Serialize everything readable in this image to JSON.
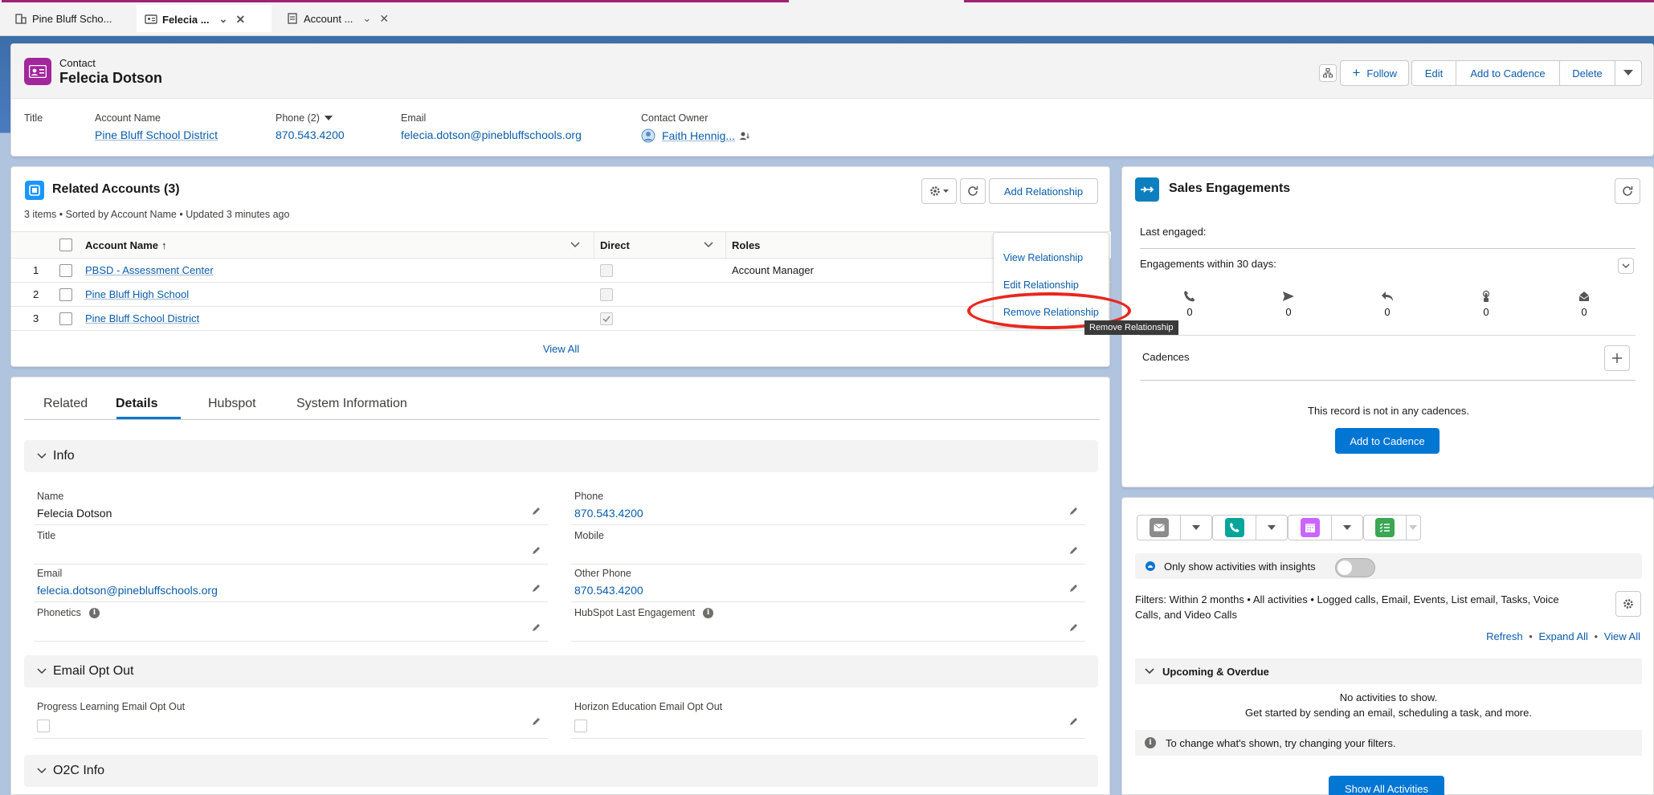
{
  "browser_tabs": [
    {
      "label": "Pine Bluff Scho...",
      "icon": "building-icon"
    },
    {
      "label": "Felecia ...",
      "icon": "contact-card-icon"
    },
    {
      "label": "Account ...",
      "icon": "page-icon"
    }
  ],
  "highlights": {
    "object_label": "Contact",
    "record_name": "Felecia Dotson",
    "actions": {
      "follow": "Follow",
      "edit": "Edit",
      "add_to_cadence": "Add to Cadence",
      "delete": "Delete"
    },
    "fields": {
      "title_label": "Title",
      "account_label": "Account Name",
      "account_value": "Pine Bluff School District",
      "phone_label": "Phone (2)",
      "phone_value": "870.543.4200",
      "email_label": "Email",
      "email_value": "felecia.dotson@pinebluffschools.org",
      "owner_label": "Contact Owner",
      "owner_value": "Faith Hennig..."
    }
  },
  "related_accounts": {
    "title": "Related Accounts (3)",
    "meta": "3 items • Sorted by Account Name • Updated 3 minutes ago",
    "add_button": "Add Relationship",
    "columns": {
      "account_name": "Account Name",
      "direct": "Direct",
      "roles": "Roles"
    },
    "rows": [
      {
        "num": "1",
        "name": "PBSD - Assessment Center",
        "direct": false,
        "role": "Account Manager"
      },
      {
        "num": "2",
        "name": "Pine Bluff High School",
        "direct": false,
        "role": ""
      },
      {
        "num": "3",
        "name": "Pine Bluff School District",
        "direct": true,
        "role": ""
      }
    ],
    "view_all": "View All",
    "row_menu": {
      "view": "View Relationship",
      "edit": "Edit Relationship",
      "remove": "Remove Relationship"
    },
    "tooltip": "Remove Relationship"
  },
  "details": {
    "tabs": [
      "Related",
      "Details",
      "Hubspot",
      "System Information"
    ],
    "active_tab": "Details",
    "sections": {
      "info": "Info",
      "email_opt_out": "Email Opt Out",
      "o2c": "O2C Info"
    },
    "fields": {
      "name_label": "Name",
      "name_value": "Felecia Dotson",
      "phone_label": "Phone",
      "phone_value": "870.543.4200",
      "title_label": "Title",
      "mobile_label": "Mobile",
      "email_label": "Email",
      "email_value": "felecia.dotson@pinebluffschools.org",
      "other_phone_label": "Other Phone",
      "other_phone_value": "870.543.4200",
      "phonetics_label": "Phonetics",
      "hubspot_label": "HubSpot Last Engagement",
      "pl_opt_out_label": "Progress Learning Email Opt Out",
      "he_opt_out_label": "Horizon Education Email Opt Out"
    }
  },
  "sales_engagements": {
    "title": "Sales Engagements",
    "last_engaged": "Last engaged:",
    "within_30": "Engagements within 30 days:",
    "metrics": [
      {
        "icon": "phone-icon",
        "value": "0"
      },
      {
        "icon": "send-icon",
        "value": "0"
      },
      {
        "icon": "reply-icon",
        "value": "0"
      },
      {
        "icon": "touch-icon",
        "value": "0"
      },
      {
        "icon": "inbox-icon",
        "value": "0"
      }
    ],
    "cadences_label": "Cadences",
    "no_cadence": "This record is not in any cadences.",
    "add_button": "Add to Cadence"
  },
  "activity": {
    "insights_label": "Only show activities with insights",
    "filters": "Filters: Within 2 months • All activities • Logged calls, Email, Events, List email, Tasks, Voice Calls, and Video Calls",
    "links": {
      "refresh": "Refresh",
      "expand": "Expand All",
      "view_all": "View All"
    },
    "upcoming": "Upcoming & Overdue",
    "no_activities": "No activities to show.",
    "get_started": "Get started by sending an email, scheduling a task, and more.",
    "tip": "To change what's shown, try changing your filters.",
    "show_all": "Show All Activities"
  },
  "colors": {
    "brand": "#0176d3",
    "link": "#0b5cab",
    "contact_icon": "#a2269c",
    "highlight_oval": "#e8281f"
  }
}
